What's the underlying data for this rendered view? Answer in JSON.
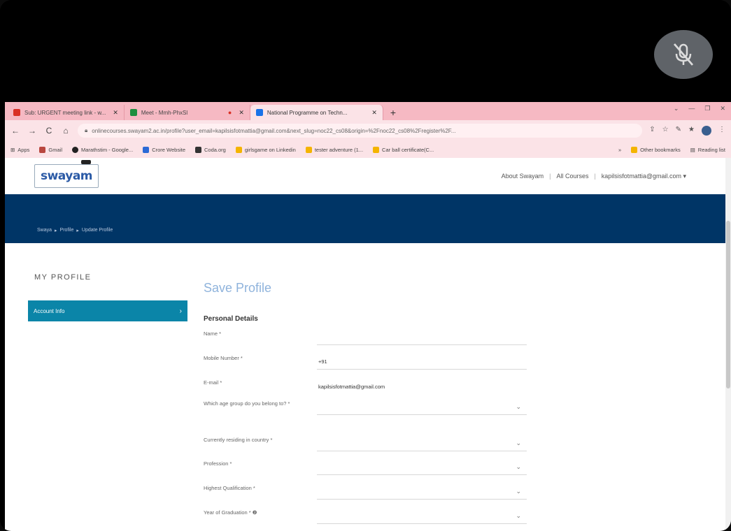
{
  "browser": {
    "tabs": [
      {
        "title": "Sub: URGENT meeting link - w...",
        "color": "#d93025"
      },
      {
        "title": "Meet - Mmh-PhxSl",
        "color": "#1a73e8"
      },
      {
        "title": "National Programme on Techn...",
        "color": "#1a73e8"
      }
    ],
    "new_tab": "+",
    "window_controls": [
      "⌄",
      "—",
      "❐",
      "✕"
    ],
    "url": "onlinecourses.swayam2.ac.in/profile?user_email=kapilsisfotmattia@gmail.com&next_slug=noc22_cs08&origin=%2Fnoc22_cs08%2Fregister%2F...",
    "nav": [
      "←",
      "→",
      "C",
      "⌂"
    ],
    "omni_icons": [
      "⇪",
      "☆",
      "✎",
      "★"
    ],
    "bookmarks": [
      "Apps",
      "Gmail",
      "Marathstim - Google...",
      "Crore Website",
      "Coda.org",
      "girlsgame on Linkedin",
      "tester adventure (1...",
      "Car ball certificate(C..."
    ],
    "bookmarks_right": [
      "»",
      "Other bookmarks",
      "Reading list"
    ]
  },
  "site": {
    "logo": "swayam",
    "header_links": [
      "About Swayam",
      "All Courses",
      "kapilsisfotmattia@gmail.com ▾"
    ],
    "breadcrumb": [
      "Swaya",
      "Profile",
      "Update Profile"
    ]
  },
  "sidebar": {
    "heading": "MY PROFILE",
    "items": [
      {
        "label": "Account Info"
      }
    ]
  },
  "form": {
    "title": "Save Profile",
    "section": "Personal Details",
    "fields": [
      {
        "label": "Name *",
        "value": "",
        "type": "text"
      },
      {
        "label": "Mobile Number *",
        "value": "+91",
        "type": "text"
      },
      {
        "label": "E-mail *",
        "value": "kapilsisfotmattia@gmail.com",
        "type": "text"
      },
      {
        "label": "Which age group do you belong to? *",
        "value": "",
        "type": "select"
      },
      {
        "label": "Currently residing in country *",
        "value": "",
        "type": "select"
      },
      {
        "label": "Profession *",
        "value": "",
        "type": "select"
      },
      {
        "label": "Highest Qualification *",
        "value": "",
        "type": "select"
      },
      {
        "label": "Year of Graduation * ❷",
        "value": "",
        "type": "select"
      }
    ]
  }
}
